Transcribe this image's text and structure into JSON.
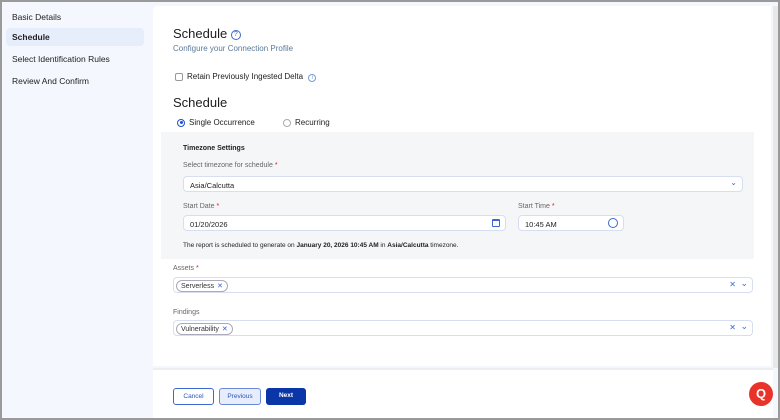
{
  "sidebar": {
    "items": [
      {
        "label": "Basic Details"
      },
      {
        "label": "Schedule",
        "active": true
      },
      {
        "label": "Select Identification Rules"
      },
      {
        "label": "Review And Confirm"
      }
    ]
  },
  "header": {
    "title": "Schedule",
    "subtitle": "Configure your Connection Profile"
  },
  "retain": {
    "label": "Retain Previously Ingested Delta",
    "checked": false
  },
  "schedule": {
    "title": "Schedule",
    "options": [
      "Single Occurrence",
      "Recurring"
    ],
    "selected": "Single Occurrence"
  },
  "timezone": {
    "title": "Timezone Settings",
    "tz_label": "Select timezone for schedule",
    "tz_value": "Asia/Calcutta",
    "date_label": "Start Date",
    "date_value": "01/20/2026",
    "time_label": "Start Time",
    "time_value": "10:45 AM",
    "note_pre": "The report is scheduled to generate on ",
    "note_date": "January 20, 2026 10:45 AM",
    "note_mid": " in ",
    "note_tz": "Asia/Calcutta",
    "note_post": " timezone."
  },
  "assets": {
    "label": "Assets",
    "chips": [
      "Serverless"
    ]
  },
  "findings": {
    "label": "Findings",
    "chips": [
      "Vulnerability"
    ]
  },
  "footer": {
    "cancel": "Cancel",
    "previous": "Previous",
    "next": "Next"
  },
  "colors": {
    "primary": "#0a36a8",
    "chat": "#e8322a"
  }
}
